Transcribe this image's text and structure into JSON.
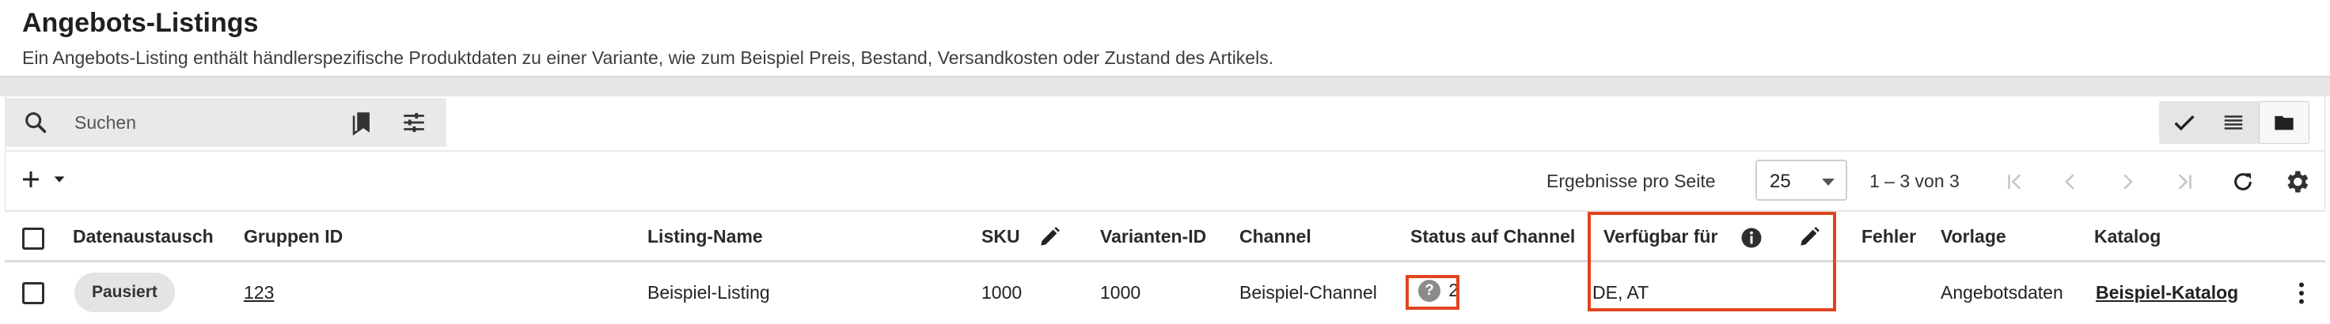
{
  "header": {
    "title": "Angebots-Listings",
    "subtitle": "Ein Angebots-Listing enthält händlerspezifische Produktdaten zu einer Variante, wie zum Beispiel Preis, Bestand, Versandkosten oder Zustand des Artikels."
  },
  "search": {
    "placeholder": "Suchen",
    "value": "",
    "icons": [
      "search-icon",
      "bookmark-icon",
      "tune-icon"
    ]
  },
  "view_toggle": {
    "options": [
      "check-icon",
      "list-icon",
      "folder-icon"
    ],
    "active": "folder-icon"
  },
  "toolbar": {
    "add_icon": "plus-icon",
    "per_page_label": "Ergebnisse pro Seite",
    "per_page_value": "25",
    "range_text": "1 – 3 von 3",
    "pager_icons": [
      "first-page-icon",
      "prev-page-icon",
      "next-page-icon",
      "last-page-icon"
    ],
    "refresh_icon": "refresh-icon",
    "settings_icon": "gear-icon"
  },
  "table": {
    "columns": [
      "Datenaustausch",
      "Gruppen ID",
      "Listing-Name",
      "SKU",
      "Varianten-ID",
      "Channel",
      "Status auf Channel",
      "Verfügbar für",
      "Fehler",
      "Vorlage",
      "Katalog"
    ],
    "rows": [
      {
        "datenaustausch": "Pausiert",
        "gruppen_id": "123",
        "listing_name": "Beispiel-Listing",
        "sku": "1000",
        "varianten_id": "1000",
        "channel": "Beispiel-Channel",
        "status_icon": "?",
        "status_count": "2",
        "verfuegbar_fuer": "DE, AT",
        "fehler": "",
        "vorlage": "Angebotsdaten",
        "katalog": "Beispiel-Katalog"
      }
    ]
  },
  "colors": {
    "highlight": "#e0441f",
    "header_bg": "#ffffff",
    "band_bg": "#e6e6e6",
    "chip_bg": "#e4e4e4"
  }
}
